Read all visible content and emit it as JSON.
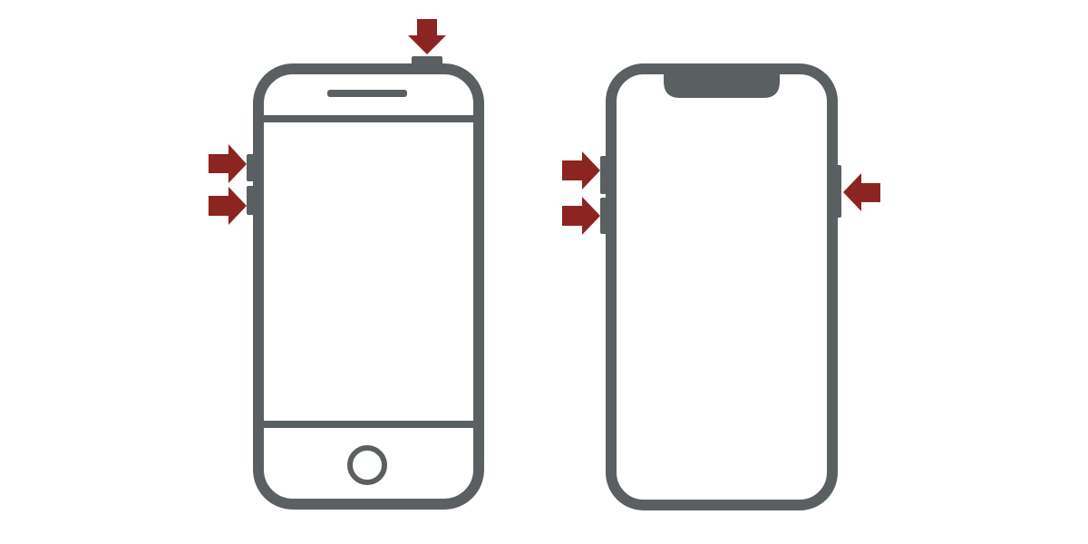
{
  "colors": {
    "outline": "#5a6061",
    "arrow": "#8c2422",
    "background": "#ffffff"
  },
  "phones": [
    {
      "id": "phone-with-home-button",
      "features": [
        "earpiece-speaker",
        "home-button",
        "top-power-button",
        "left-volume-up-button",
        "left-volume-down-button"
      ],
      "highlighted_buttons": [
        "top-power-button",
        "left-volume-up-button",
        "left-volume-down-button"
      ]
    },
    {
      "id": "phone-with-notch",
      "features": [
        "notch",
        "left-volume-up-button",
        "left-volume-down-button",
        "right-side-button"
      ],
      "highlighted_buttons": [
        "left-volume-up-button",
        "left-volume-down-button",
        "right-side-button"
      ]
    }
  ],
  "icons": [
    "arrow-down-icon",
    "arrow-right-icon",
    "arrow-left-icon"
  ]
}
